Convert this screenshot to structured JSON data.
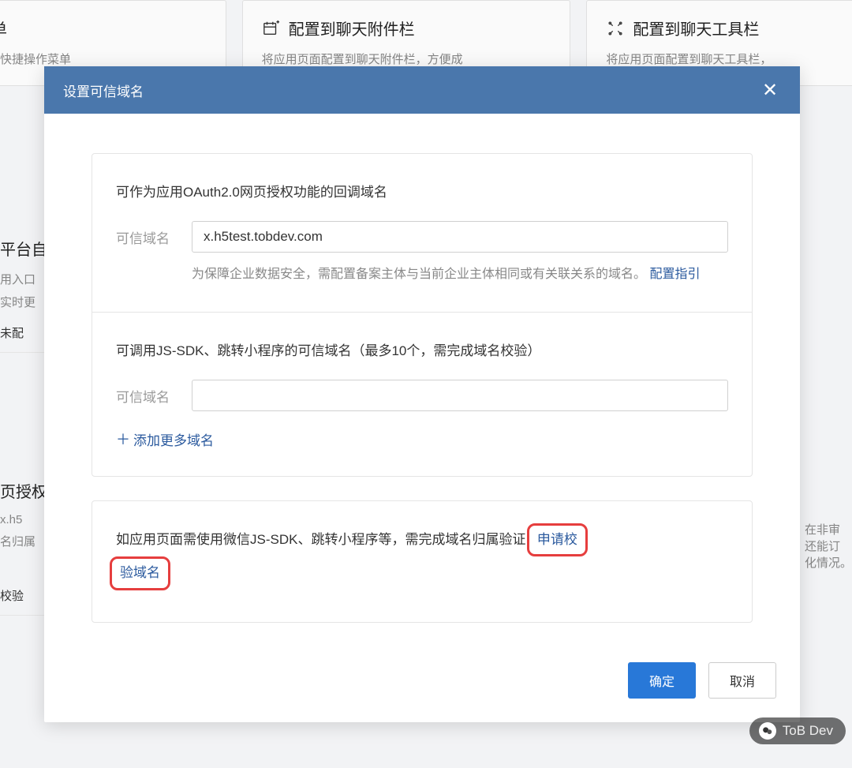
{
  "bg_cards": [
    {
      "icon": "☰",
      "title": "定义菜单",
      "desc": "会话的底部配置快捷操作菜单"
    },
    {
      "icon": "📅⁺",
      "title": "配置到聊天附件栏",
      "desc": "将应用页面配置到聊天附件栏，方便成"
    },
    {
      "icon": "⌘",
      "title": "配置到聊天工具栏",
      "desc": "将应用页面配置到聊天工具栏，"
    }
  ],
  "bg_left": {
    "t1": "平台自",
    "d1": "用入口",
    "d2": "实时更",
    "d3": "未配",
    "t2": "页授权",
    "d4": "x.h5",
    "d5": "名归属",
    "d6": "校验"
  },
  "bg_right": {
    "l1": "在非审",
    "l2": "还能订",
    "l3": "化情况。"
  },
  "modal": {
    "title": "设置可信域名",
    "section1": {
      "title": "可作为应用OAuth2.0网页授权功能的回调域名",
      "label": "可信域名",
      "value": "x.h5test.tobdev.com",
      "help_prefix": "为保障企业数据安全，需配置备案主体与当前企业主体相同或有关联关系的域名。",
      "help_link": "配置指引"
    },
    "section2": {
      "title": "可调用JS-SDK、跳转小程序的可信域名（最多10个，需完成域名校验）",
      "label": "可信域名",
      "value": "",
      "add_more": "添加更多域名"
    },
    "verify": {
      "text_before": "如应用页面需使用微信JS-SDK、跳转小程序等，需完成域名归属验证",
      "link_p1": "申请校",
      "link_p2": "验域名"
    },
    "footer": {
      "confirm": "确定",
      "cancel": "取消"
    }
  },
  "watermark": "ToB Dev"
}
